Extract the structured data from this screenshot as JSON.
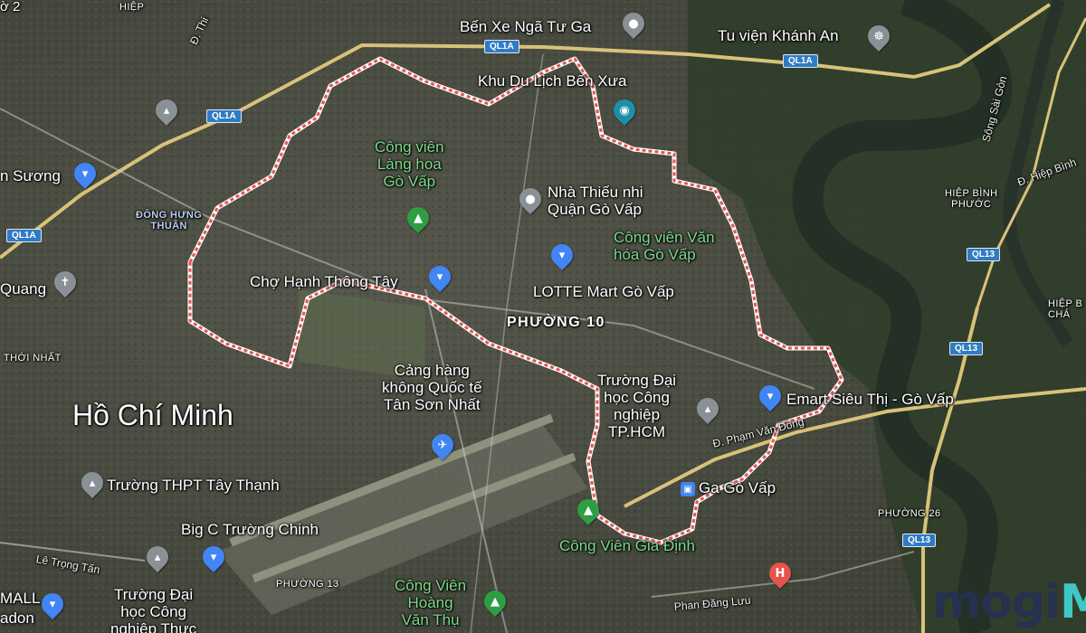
{
  "map": {
    "city": "Hồ Chí Minh",
    "ward": "PHƯỜNG 10",
    "places": {
      "ben_xe": "Bến Xe Ngã Tư Ga",
      "tu_vien": "Tu viện Khánh An",
      "khu_du_lich": "Khu Du Lịch Bến Xưa",
      "cong_vien_lang_hoa": [
        "Công viên",
        "Làng hoa",
        "Gò Vấp"
      ],
      "nha_thieu_nhi": [
        "Nhà Thiếu nhi",
        "Quận Gò Vấp"
      ],
      "cong_vien_van_hoa": [
        "Công viên Văn",
        "hóa Gò Vấp"
      ],
      "cho": "Chợ Hạnh Thông Tây",
      "lotte": "LOTTE Mart Gò Vấp",
      "san_bay": [
        "Cảng hàng",
        "không Quốc tế",
        "Tân Sơn Nhất"
      ],
      "truong_cong_nghiep": [
        "Trường Đại",
        "học Công",
        "nghiệp",
        "TP.HCM"
      ],
      "emart": "Emart Siêu Thị - Gò Vấp",
      "an_suong": "n Sương",
      "quang": "Quang",
      "truong_thpt": "Trường THPT Tây Thạnh",
      "big_c": "Big C Trường Chinh",
      "ga_go_vap": "Ga Gò Vấp",
      "cong_vien_gia_dinh": "Công Viên Gia Định",
      "cong_vien_hoang_van_thu": [
        "Công Viên",
        "Hoàng",
        "Văn Thụ"
      ],
      "truong_dai_hoc_cong_nghiep_thuc_pham": [
        "Trường Đại",
        "học Công",
        "nghiệp Thực"
      ],
      "mall": "MALL",
      "adon": "adon"
    },
    "small_labels": {
      "hiep": "HIỆP",
      "to2": "ờ 2",
      "thoi_nhat": "THỚI NHẤT",
      "phuong13": "PHƯỜNG 13",
      "phuong26": "PHƯỜNG 26",
      "hiep_binh_phuoc": [
        "HIỆP BÌNH",
        "PHƯỚC"
      ],
      "hiep_b": [
        "HIỆP B",
        "CHÁ"
      ],
      "dong_hung_thuan": [
        "ĐÔNG HƯNG",
        "THUẬN"
      ]
    },
    "streets": {
      "pham_van_dong": "Đ. Phạm Văn Đồng",
      "le_trong_tan": "Lê Trọng Tấn",
      "phan_dang_luu": "Phan Đăng Lưu",
      "song_sai_gon": "Sông Sài Gòn",
      "hiep_binh": "Đ. Hiệp Bình",
      "d_thi": "Đ. Thi"
    },
    "shields": {
      "ql1a": "QL1A",
      "ql13": "QL13"
    },
    "brand": {
      "logo_part1": "mogi",
      "logo_part2": "M"
    },
    "colors": {
      "boundary": "#e8534a",
      "water": "#2e3a2c",
      "highway": "#d8c27a",
      "shield": "#2f7cc4"
    }
  }
}
